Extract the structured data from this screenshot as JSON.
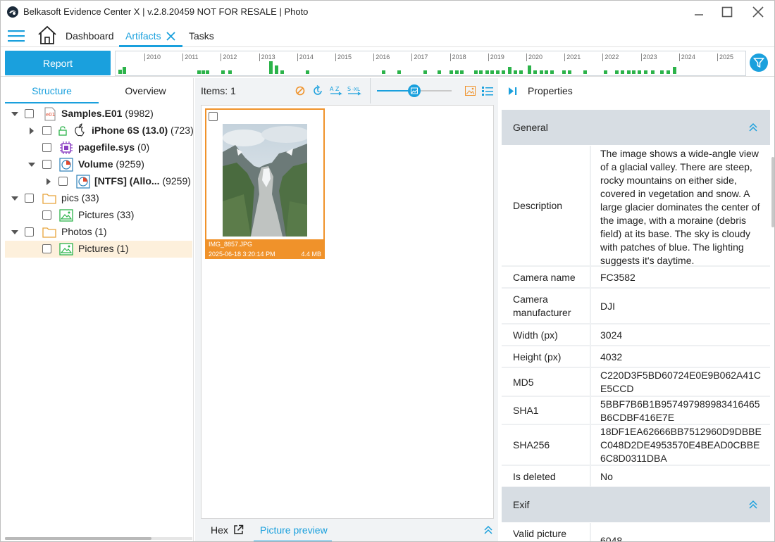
{
  "window": {
    "title": "Belkasoft Evidence Center X | v.2.8.20459 NOT FOR RESALE | Photo"
  },
  "nav": {
    "dashboard": "Dashboard",
    "artifacts": "Artifacts",
    "tasks": "Tasks"
  },
  "timeline": {
    "report_label": "Report",
    "years": [
      "2010",
      "2011",
      "2012",
      "2013",
      "2014",
      "2015",
      "2016",
      "2017",
      "2018",
      "2019",
      "2020",
      "2021",
      "2022",
      "2023",
      "2024",
      "2025"
    ],
    "bar_color": "#2cb34a"
  },
  "left": {
    "tab_structure": "Structure",
    "tab_overview": "Overview",
    "tree": [
      {
        "name": "Samples.E01",
        "count": "(9982)"
      },
      {
        "name": "iPhone 6S (13.0)",
        "count": "(723)"
      },
      {
        "name": "pagefile.sys",
        "count": "(0)"
      },
      {
        "name": "Volume",
        "count": "(9259)"
      },
      {
        "name": "[NTFS] (Allo...",
        "count": "(9259)"
      },
      {
        "name": "pics",
        "count": "(33)"
      },
      {
        "name": "Pictures",
        "count": "(33)"
      },
      {
        "name": "Photos",
        "count": "(1)"
      },
      {
        "name": "Pictures",
        "count": "(1)"
      }
    ]
  },
  "middle": {
    "items_label": "Items: 1",
    "thumb": {
      "filename": "IMG_8857.JPG",
      "datetime": "2025-06-18 3:20:14 PM",
      "size": "4.4 MB"
    },
    "bottom_tab_hex": "Hex",
    "bottom_tab_preview": "Picture preview"
  },
  "right": {
    "title": "Properties",
    "general_label": "General",
    "exif_label": "Exif",
    "props": [
      {
        "key": "Description",
        "value": "The image shows a wide-angle view of a glacial valley. There are steep, rocky mountains on either side, covered in vegetation and snow. A large glacier dominates the center of the image, with a moraine (debris field) at its base. The sky is cloudy with patches of blue. The lighting suggests it's daytime."
      },
      {
        "key": "Camera name",
        "value": "FC3582"
      },
      {
        "key": "Camera manufacturer",
        "value": "DJI"
      },
      {
        "key": "Width (px)",
        "value": "3024"
      },
      {
        "key": "Height (px)",
        "value": "4032"
      },
      {
        "key": "MD5",
        "value": "C220D3F5BD60724E0E9B062A41CE5CCD"
      },
      {
        "key": "SHA1",
        "value": "5BBF7B6B1B957497989983416465B6CDBF416E7E"
      },
      {
        "key": "SHA256",
        "value": "18DF1EA62666BB7512960D9DBBEC048D2DE4953570E4BEAD0CBBE6C8D0311DBA"
      },
      {
        "key": "Is deleted",
        "value": "No"
      }
    ],
    "exif_props": [
      {
        "key": "Valid picture",
        "value": "6048"
      }
    ]
  },
  "colors": {
    "accent": "#1aa0dd",
    "selection": "#f0922a",
    "selected_row": "#fdf0dc"
  }
}
